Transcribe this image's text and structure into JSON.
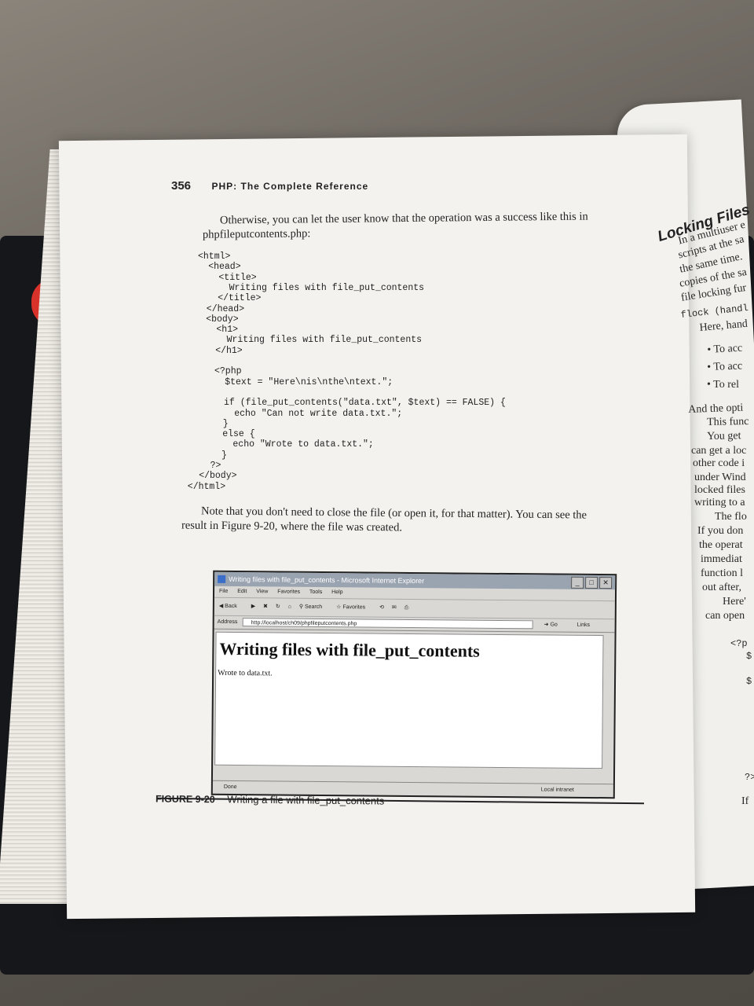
{
  "header": {
    "page_number": "356",
    "running_title": "PHP: The Complete Reference"
  },
  "intro": [
    "Otherwise, you can let the user know that the operation was a success like this in",
    "phpfileputcontents.php:"
  ],
  "code_lines": [
    "<html>",
    "  <head>",
    "    <title>",
    "      Writing files with file_put_contents",
    "    </title>",
    "  </head>",
    "  <body>",
    "    <h1>",
    "      Writing files with file_put_contents",
    "    </h1>",
    "",
    "    <?php",
    "      $text = \"Here\\nis\\nthe\\ntext.\";",
    "",
    "      if (file_put_contents(\"data.txt\", $text) == FALSE) {",
    "        echo \"Can not write data.txt.\";",
    "      }",
    "      else {",
    "        echo \"Wrote to data.txt.\";",
    "      }",
    "    ?>",
    "  </body>",
    "</html>"
  ],
  "note": [
    "Note that you don't need to close the file (or open it, for that matter). You can see the",
    "result in Figure 9-20, where the file was created."
  ],
  "browser": {
    "title": "Writing files with file_put_contents - Microsoft Internet Explorer",
    "menu": [
      "File",
      "Edit",
      "View",
      "Favorites",
      "Tools",
      "Help"
    ],
    "toolbar": [
      "Back",
      "Search",
      "Favorites"
    ],
    "address_label": "Address",
    "address": "http://localhost/ch09/phpfileputcontents.php",
    "go": "Go",
    "links": "Links",
    "heading": "Writing files with file_put_contents",
    "body_text": "Wrote to data.txt.",
    "status_left": "Done",
    "status_right": "Local intranet"
  },
  "figure": {
    "label": "FIGURE 9-20",
    "caption": "Writing a file with file_put_contents"
  },
  "right_page": {
    "title": "Locking Files",
    "lines": [
      "In a multiuser e",
      "scripts at the sa",
      "the same time.",
      "copies of the sa",
      "file locking fur",
      "flock (handl",
      "Here, hand",
      "• To acc",
      "• To acc",
      "• To rel",
      "And the opti",
      "This func",
      "You get",
      "can get a loc",
      "other code i",
      "under Wind",
      "locked files",
      "writing to a",
      "The flo",
      "If you don",
      "the operat",
      "immediat",
      "function l",
      "out after,",
      "Here'",
      "can open",
      "<?p",
      "$",
      "$",
      "?>",
      "If"
    ]
  }
}
